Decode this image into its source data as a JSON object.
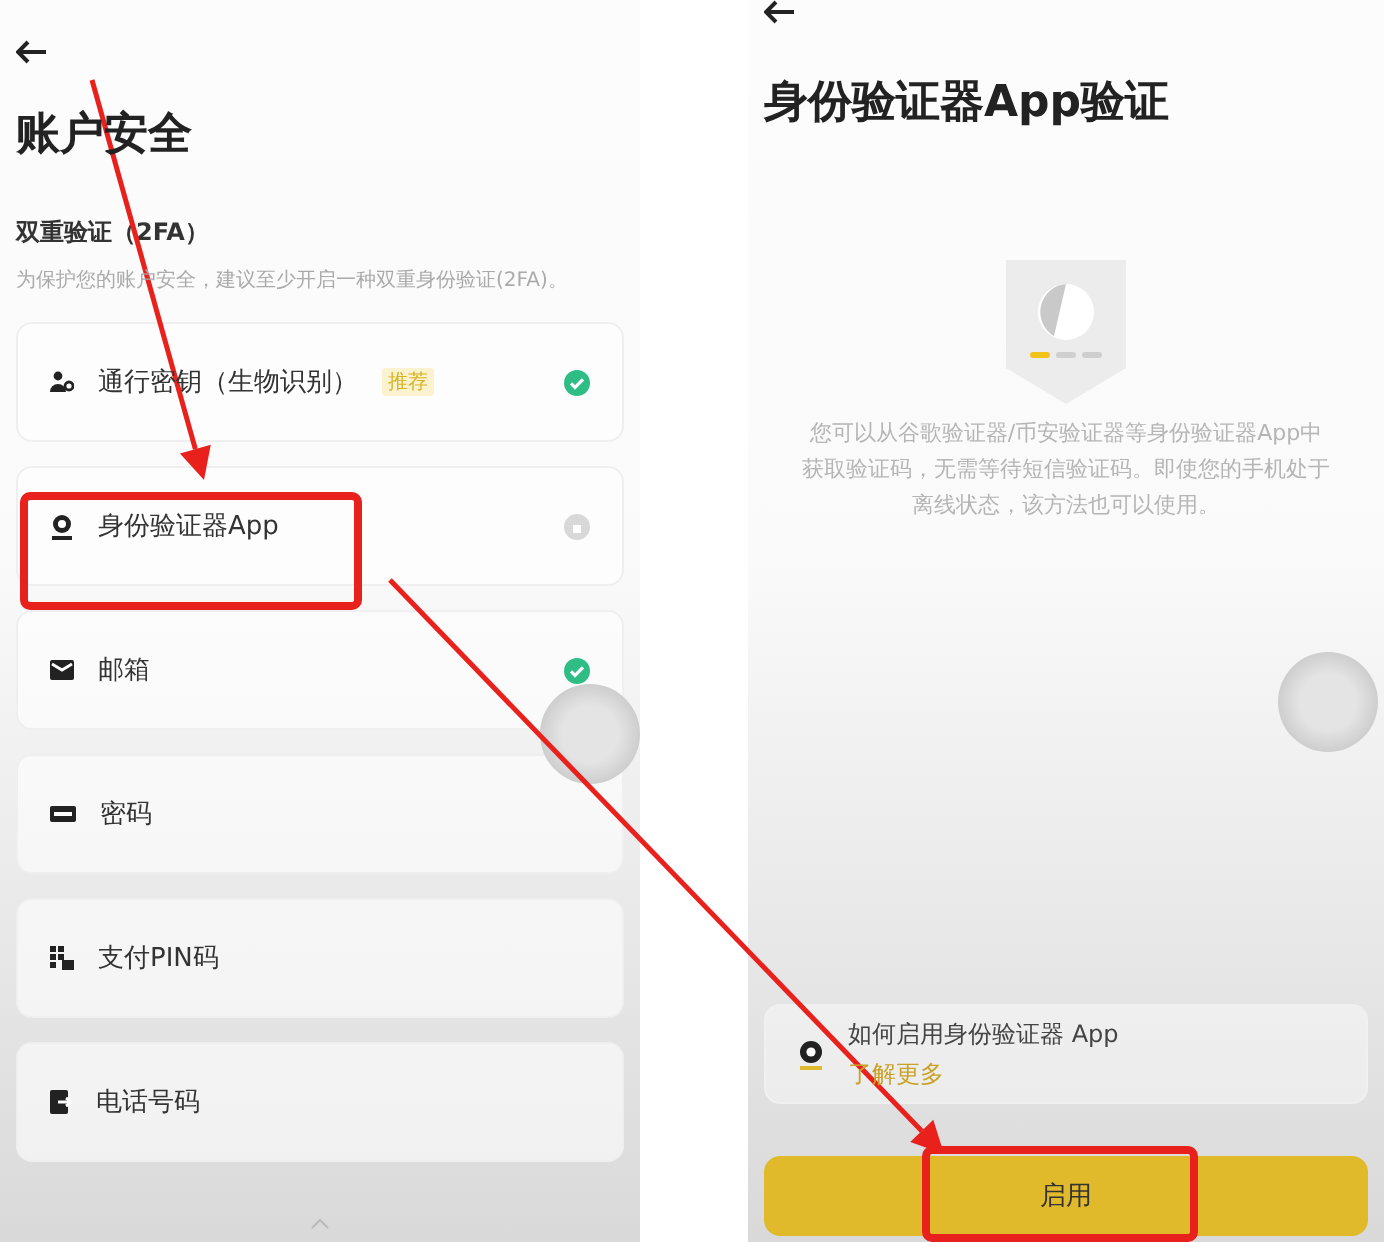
{
  "left_screen": {
    "title": "账户安全",
    "section": {
      "heading": "双重验证（2FA）",
      "description": "为保护您的账户安全，建议至少开启一种双重身份验证(2FA)。"
    },
    "items": [
      {
        "label": "通行密钥（生物识别）",
        "tag": "推荐",
        "enabled": true
      },
      {
        "label": "身份验证器App",
        "enabled": false
      },
      {
        "label": "邮箱",
        "enabled": true
      },
      {
        "label": "密码"
      },
      {
        "label": "支付PIN码"
      },
      {
        "label": "电话号码"
      }
    ]
  },
  "right_screen": {
    "title": "身份验证器App验证",
    "description": "您可以从谷歌验证器/币安验证器等身份验证器App中获取验证码，无需等待短信验证码。即使您的手机处于离线状态，该方法也可以使用。",
    "help": {
      "title": "如何启用身份验证器 App",
      "link": "了解更多"
    },
    "button": "启用"
  }
}
